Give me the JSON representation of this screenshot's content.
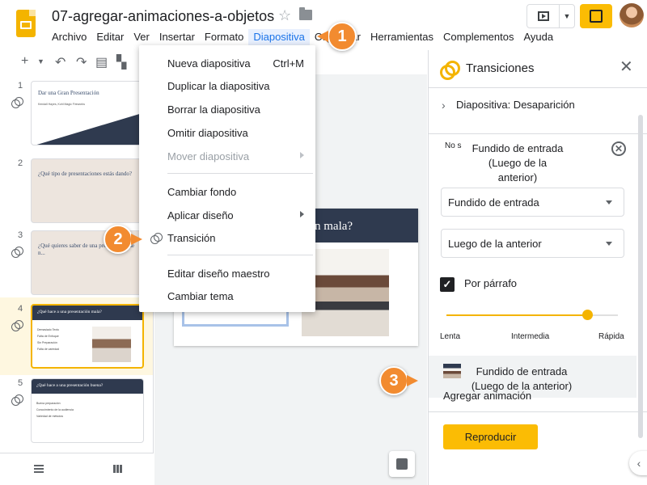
{
  "header": {
    "doc_title": "07-agregar-animaciones-a-objetos",
    "menu": [
      "Archivo",
      "Editar",
      "Ver",
      "Insertar",
      "Formato",
      "Diapositiva",
      "Organizar",
      "Herramientas",
      "Complementos",
      "Ayuda"
    ],
    "menu_active_index": 5,
    "star_icon": "star-icon",
    "folder_icon": "folder-icon"
  },
  "filmstrip": {
    "slides": [
      {
        "num": "1",
        "title": "Dar una Gran Presentación",
        "subtitle": "Kendall Hayes, Kohl Magic Fireworks",
        "style": "title"
      },
      {
        "num": "2",
        "title": "¿Qué tipo de presentaciones estás dando?",
        "style": "beige"
      },
      {
        "num": "3",
        "title": "¿Qué quieres saber de una presentación de n...",
        "style": "beige"
      },
      {
        "num": "4",
        "title": "¿Qué hace a una presentación mala?",
        "style": "content",
        "bullets": [
          "Demasiado Texto",
          "Falta de Enfoque",
          "Sin Preparación",
          "Falta de variedad"
        ]
      },
      {
        "num": "5",
        "title": "¿Qué hace a una presentación buena?",
        "style": "content",
        "bullets": [
          "Buena preparación",
          "Conocimiento de la audiencia",
          "Variedad de métodos"
        ]
      }
    ],
    "selected_index": 3
  },
  "canvas": {
    "slide_title": "n mala?"
  },
  "dropdown": {
    "items": [
      {
        "label": "Nueva diapositiva",
        "shortcut": "Ctrl+M"
      },
      {
        "label": "Duplicar la diapositiva"
      },
      {
        "label": "Borrar la diapositiva"
      },
      {
        "label": "Omitir diapositiva"
      },
      {
        "label": "Mover diapositiva",
        "submenu": true,
        "disabled": true
      },
      {
        "label": "Cambiar fondo"
      },
      {
        "label": "Aplicar diseño",
        "submenu": true
      },
      {
        "label": "Transición",
        "icon": "transition-icon"
      },
      {
        "label": "Editar diseño maestro"
      },
      {
        "label": "Cambiar tema"
      }
    ]
  },
  "panel": {
    "title": "Transiciones",
    "slide_transition": "Diapositiva: Desaparición",
    "anim_prefix": "No s",
    "anim_summary_line1": "Fundido de entrada",
    "anim_summary_line2": "(Luego de la anterior)",
    "effect_select": "Fundido de entrada",
    "start_select": "Luego de la anterior",
    "by_paragraph_label": "Por párrafo",
    "by_paragraph_checked": true,
    "speed_value": 0.82,
    "speed_labels": [
      "Lenta",
      "Intermedia",
      "Rápida"
    ],
    "anim2_line1": "Fundido de entrada",
    "anim2_line2": "(Luego de la anterior)",
    "add_animation": "Agregar animación",
    "play_button": "Reproducir"
  },
  "callouts": [
    "1",
    "2",
    "3"
  ],
  "colors": {
    "accent": "#fbbc04",
    "callout": "#f28b30",
    "menu_active_bg": "#e8f0fe",
    "slide_band": "#2f3a4f"
  }
}
